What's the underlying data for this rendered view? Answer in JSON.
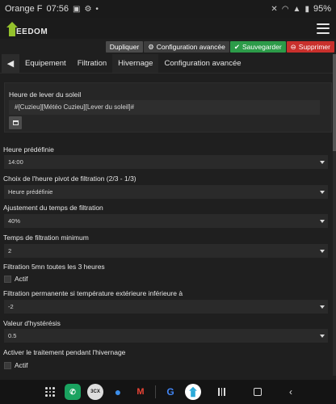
{
  "status_bar": {
    "carrier": "Orange F",
    "time": "07:56",
    "battery": "95%",
    "icons": [
      "image-icon",
      "settings-icon",
      "volume-mute-icon",
      "wifi-icon",
      "signal-icon",
      "battery-icon"
    ]
  },
  "header": {
    "logo_text": "EEDOM",
    "brand_color": "#94c12c"
  },
  "actions": {
    "duplicate": "Dupliquer",
    "config": "Configuration avancée",
    "save": "Sauvegarder",
    "delete": "Supprimer"
  },
  "tabs": [
    "Equipement",
    "Filtration",
    "Hivernage",
    "Configuration avancée"
  ],
  "active_tab": "Hivernage",
  "sunrise_panel": {
    "label": "Heure de lever du soleil",
    "value": "#[Cuzieu][Météo Cuzieu][Lever du soleil]#"
  },
  "fields": {
    "heure_predefinie": {
      "label": "Heure prédéfinie",
      "value": "14:00"
    },
    "pivot": {
      "label": "Choix de l'heure pivot de filtration (2/3 - 1/3)",
      "value": "Heure prédéfinie"
    },
    "ajustement": {
      "label": "Ajustement du temps de filtration",
      "value": "40%"
    },
    "temps_min": {
      "label": "Temps de filtration minimum",
      "value": "2"
    },
    "filtration_5mn": {
      "label": "Filtration 5mn toutes les 3 heures",
      "checkbox_label": "Actif"
    },
    "filtration_permanente": {
      "label": "Filtration permanente si température extérieure inférieure à",
      "value": "-2"
    },
    "hysteresis": {
      "label": "Valeur d'hystérésis",
      "value": "0.5"
    },
    "traitement": {
      "label": "Activer le traitement pendant l'hivernage",
      "checkbox_label": "Actif"
    }
  },
  "dock": {
    "apps": [
      "apps-grid-icon",
      "phone-app-icon",
      "3cx-app-icon",
      "messages-app-icon",
      "gmail-app-icon",
      "google-app-icon",
      "jeedom-app-icon",
      "home-app-icon"
    ],
    "app_3cx_text": "3CX",
    "gmail_text": "M",
    "google_text": "G"
  }
}
